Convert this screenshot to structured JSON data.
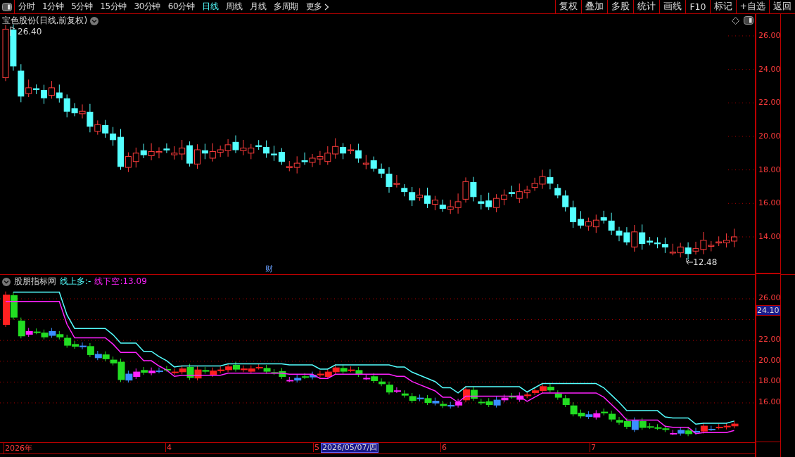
{
  "toolbar": {
    "periods": [
      {
        "label": "分时",
        "selected": false
      },
      {
        "label": "1分钟",
        "selected": false
      },
      {
        "label": "5分钟",
        "selected": false
      },
      {
        "label": "15分钟",
        "selected": false
      },
      {
        "label": "30分钟",
        "selected": false
      },
      {
        "label": "60分钟",
        "selected": false
      },
      {
        "label": "日线",
        "selected": true
      },
      {
        "label": "周线",
        "selected": false
      },
      {
        "label": "月线",
        "selected": false
      },
      {
        "label": "多周期",
        "selected": false
      },
      {
        "label": "更多",
        "selected": false
      }
    ],
    "buttons": [
      "复权",
      "叠加",
      "多股",
      "统计",
      "画线",
      "F10",
      "标记",
      "+自选",
      "返回"
    ]
  },
  "main_chart": {
    "title": "宝色股份(日线,前复权)",
    "high_label": "26.40",
    "low_label": "12.48",
    "event_mark": "财",
    "price_ticks": [
      "26.00",
      "24.00",
      "22.00",
      "20.00",
      "18.00",
      "16.00",
      "14.00"
    ]
  },
  "indicator": {
    "name": "股朋指标网",
    "long_label": "线上多:-",
    "short_label": "线下空:13.09",
    "price_ticks": [
      "26.00",
      "22.00",
      "20.00",
      "18.00",
      "16.00"
    ],
    "current_price": "24.10"
  },
  "date_axis": {
    "labels": [
      "2026年",
      "4",
      "5",
      "6",
      "7"
    ],
    "cursor_date": "2026/05/07/四"
  }
}
